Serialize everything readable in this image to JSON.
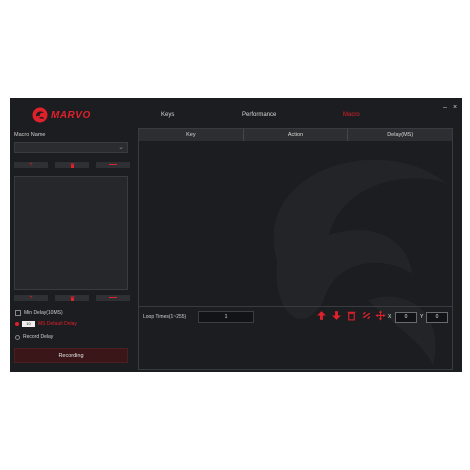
{
  "brand": {
    "name": "MARVO"
  },
  "tabs": [
    {
      "label": "Keys",
      "active": false
    },
    {
      "label": "Performance",
      "active": false
    },
    {
      "label": "Macro",
      "active": true
    }
  ],
  "window": {
    "minimize": "–",
    "close": "×"
  },
  "sidebar": {
    "macro_name_label": "Macro Name",
    "macro_select_value": "",
    "list_buttons": {
      "add": "+",
      "delete": "🗑",
      "remove": "—"
    },
    "event_buttons": {
      "add": "+",
      "delete": "🗑",
      "remove": "—"
    },
    "options": {
      "min_delay": "Min Delay(10MS)",
      "ms_value": "10",
      "ms_default": "MS Default Delay",
      "record_delay": "Record Delay"
    },
    "recording_label": "Recording"
  },
  "table": {
    "headers": [
      "Key",
      "Action",
      "Delay(MS)"
    ],
    "loop_label": "Loop Times(1~255)",
    "loop_value": "1",
    "x_label": "X",
    "x_value": "0",
    "y_label": "Y",
    "y_value": "0"
  },
  "colors": {
    "accent": "#e0202a",
    "panel": "#1c1d20"
  },
  "icons": [
    "arrow-up-icon",
    "arrow-down-icon",
    "trash-icon",
    "link-icon",
    "move-icon"
  ]
}
